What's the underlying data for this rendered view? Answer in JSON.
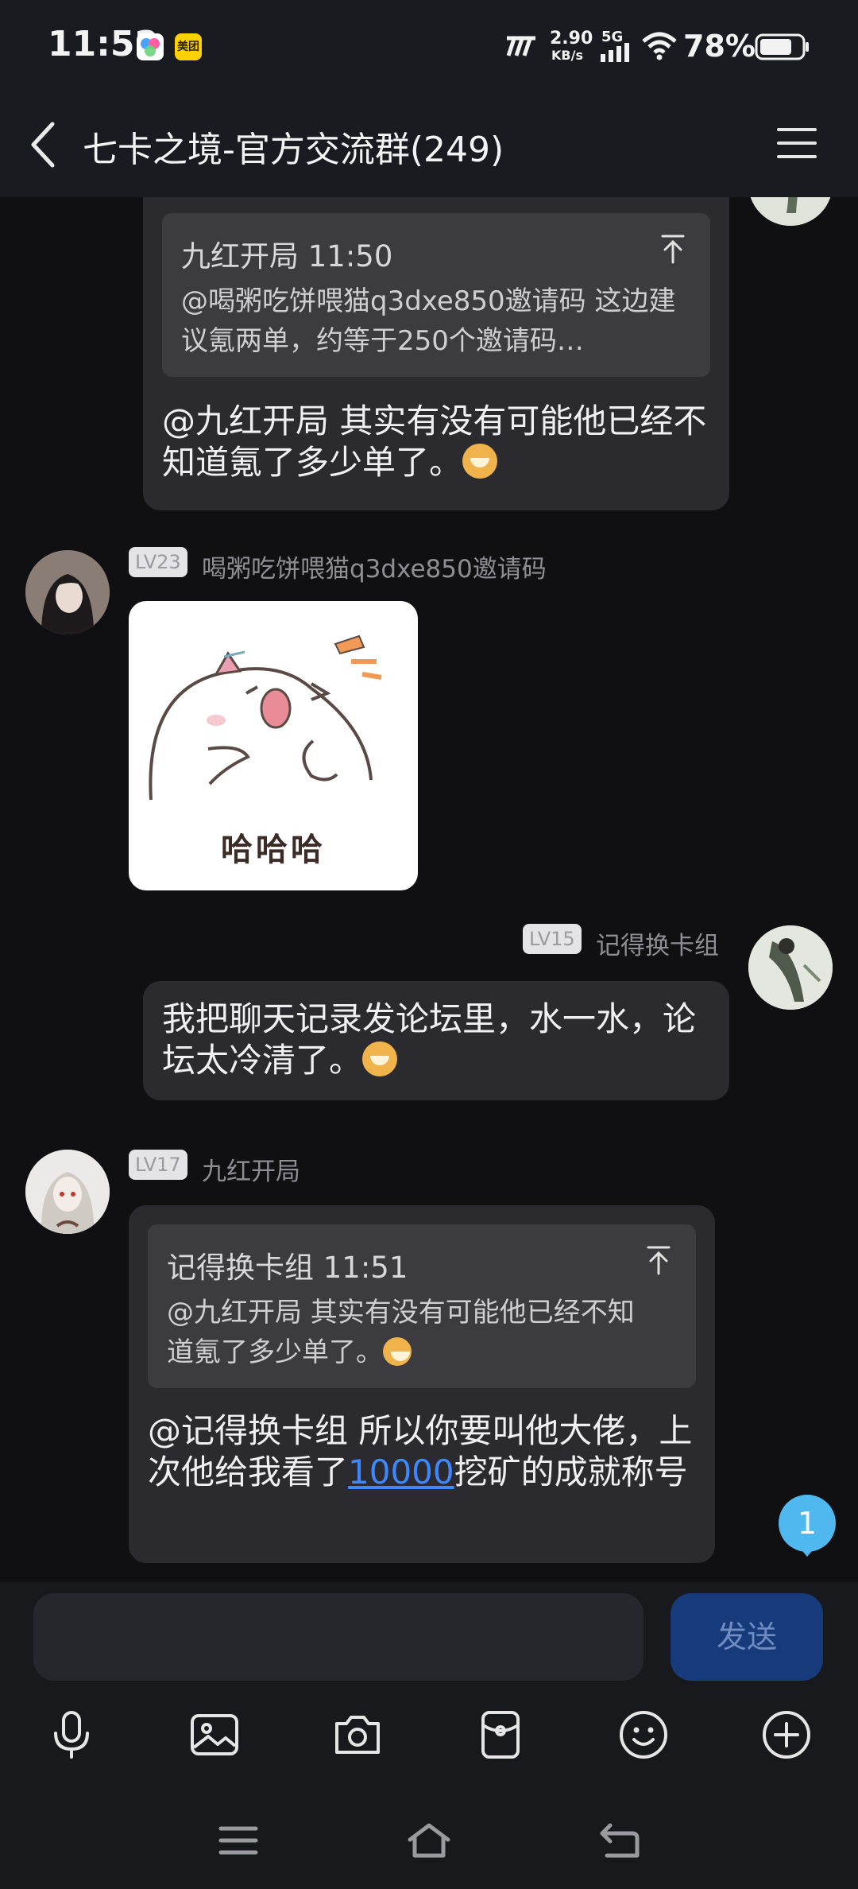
{
  "status_bar": {
    "time": "11:52",
    "app_icons": [
      "multicolor-app-icon",
      "meituan-icon"
    ],
    "app_badge_text": "美团",
    "net_speed_value": "2.90",
    "net_speed_unit": "KB/s",
    "network": "5G",
    "battery_percent": "78%",
    "battery_level": 0.78
  },
  "header": {
    "title": "七卡之境-官方交流群(249)"
  },
  "messages": [
    {
      "quote_author_time": "九红开局 11:50",
      "quote_text": "@喝粥吃饼喂猫q3dxe850邀请码 这边建议氪两单，约等于250个邀请码…",
      "text": "@九红开局 其实有没有可能他已经不知道氪了多少单了。"
    },
    {
      "level": "LV23",
      "nickname": "喝粥吃饼喂猫q3dxe850邀请码",
      "sticker_text": "哈哈哈"
    },
    {
      "level": "LV15",
      "nickname": "记得换卡组",
      "text": "我把聊天记录发论坛里，水一水，论坛太冷清了。"
    },
    {
      "level": "LV17",
      "nickname": "九红开局",
      "quote_author_time": "记得换卡组 11:51",
      "quote_text": "@九红开局 其实有没有可能他已经不知道氪了多少单了。",
      "text_before_link": "@记得换卡组 所以你要叫他大佬，上次他给我看了",
      "link_text": "10000",
      "text_after_link": "挖矿的成就称号"
    }
  ],
  "unread_badge": "1",
  "input": {
    "placeholder": "",
    "send_label": "发送"
  },
  "toolbar": [
    "microphone-icon",
    "image-icon",
    "camera-icon",
    "red-packet-icon",
    "emoji-icon",
    "plus-icon"
  ],
  "nav_bar": [
    "menu-icon",
    "home-icon",
    "back-icon"
  ],
  "colors": {
    "background": "#101013",
    "bubble": "#2b2b2f",
    "quote": "#3b3b40",
    "link": "#3f86ff",
    "send_button": "#173a7a",
    "badge": "#4fb8ee"
  }
}
